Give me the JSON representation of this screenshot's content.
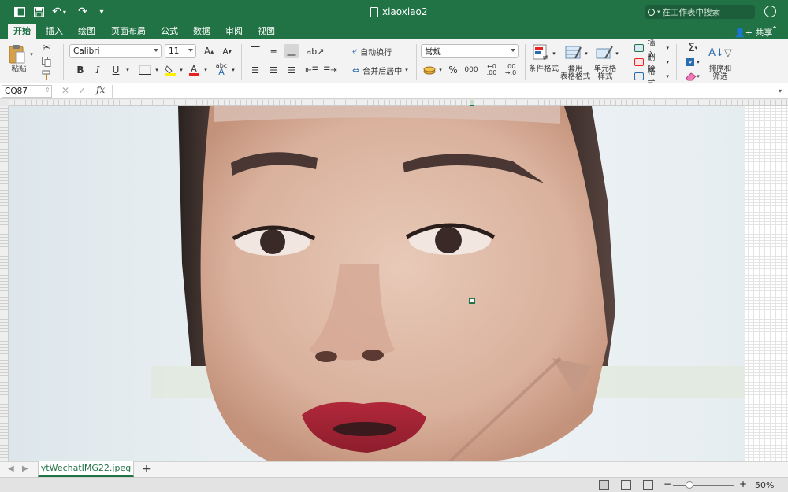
{
  "window": {
    "title": "xiaoxiao2"
  },
  "search": {
    "placeholder": "在工作表中搜索"
  },
  "tabs": [
    "开始",
    "插入",
    "绘图",
    "页面布局",
    "公式",
    "数据",
    "审阅",
    "视图"
  ],
  "share_label": "共享",
  "ribbon": {
    "paste_label": "粘贴",
    "font_name": "Calibri",
    "font_size": "11",
    "wrap_text_label": "自动换行",
    "merge_center_label": "合并后居中",
    "number_format": "常规",
    "percent_symbol": "%",
    "thousands_symbol": "000",
    "conditional_format_label": "条件格式",
    "table_format_label": "套用\n表格格式",
    "cell_style_label": "单元格\n样式",
    "insert_label": "插入",
    "delete_label": "删除",
    "format_label": "格式",
    "sort_filter_label": "排序和\n筛选"
  },
  "formula_bar": {
    "name_box": "CQ87",
    "fx": "fx",
    "formula": ""
  },
  "sheets": [
    {
      "name": "ytWechatIMG22.jpeg",
      "active": true
    }
  ],
  "status": {
    "zoom": "50%"
  },
  "colors": {
    "accent": "#217346",
    "ribbon_bg": "#f3f3f3"
  },
  "icons": [
    "sidebar-icon",
    "save-icon",
    "undo-icon",
    "redo-icon",
    "customize-icon",
    "search-icon",
    "smiley-icon",
    "paste-icon",
    "cut-icon",
    "copy-icon",
    "format-painter-icon"
  ]
}
